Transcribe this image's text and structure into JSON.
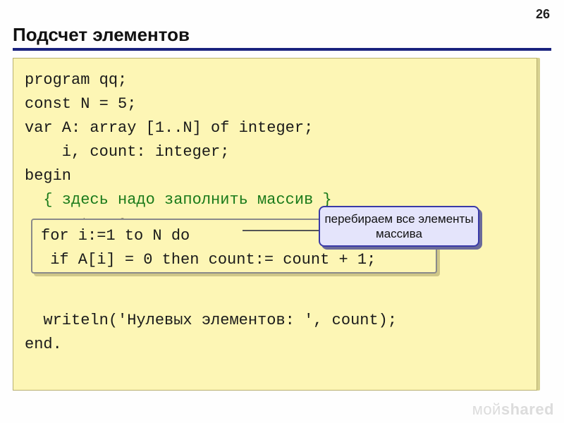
{
  "page_number": "26",
  "title": "Подсчет элементов",
  "code": {
    "l1": "program qq;",
    "l2": "const N = 5;",
    "l3": "var A: array [1..N] of integer;",
    "l4": "    i, count: integer;",
    "l5": "begin",
    "l6_comment": "  { здесь надо заполнить массив }",
    "l7": "  count:= 0;",
    "l8": "for i:=1 to N do",
    "l9": " if A[i] = 0 then count:= count + 1;",
    "l10": "  writeln('Нулевых элементов: ', count);",
    "l11": "end."
  },
  "callout": "перебираем все элементы массива",
  "watermark_thin": "мой",
  "watermark_bold": "shared"
}
